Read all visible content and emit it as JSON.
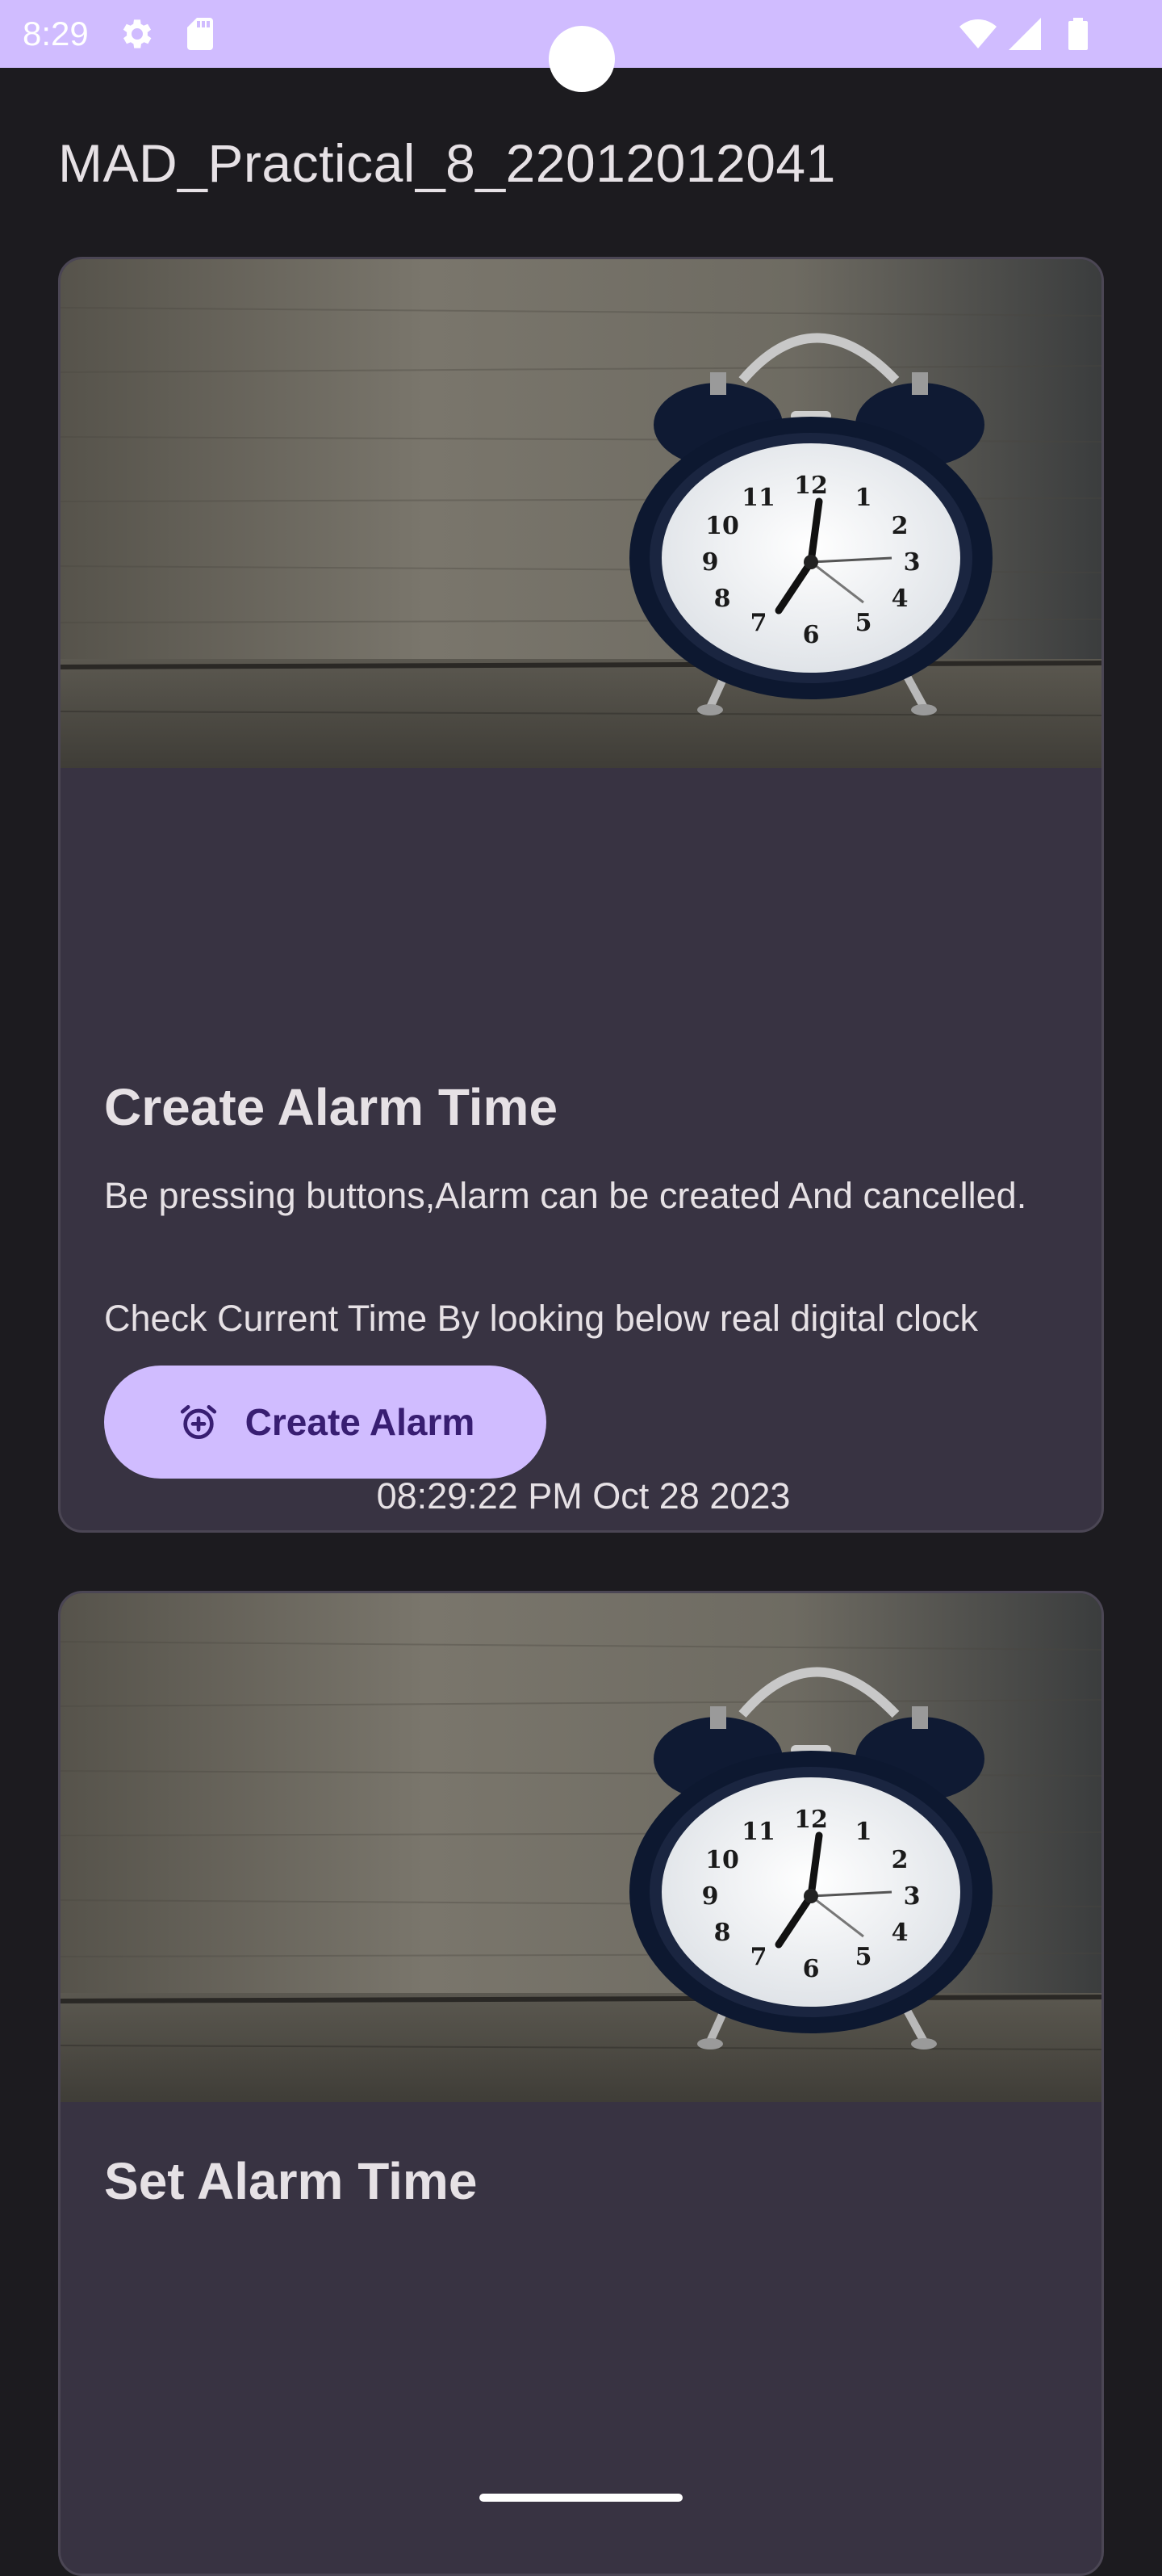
{
  "status_bar": {
    "time": "8:29",
    "icons": [
      "gear-icon",
      "sd-card-icon",
      "wifi-icon",
      "signal-icon",
      "battery-icon"
    ],
    "color": "#d0bcff"
  },
  "app": {
    "title": "MAD_Practical_8_22012012041"
  },
  "card_create": {
    "image": "alarm-clock-image",
    "title": "Create Alarm Time",
    "description": "Be pressing buttons,Alarm can be created And cancelled.",
    "hint": "Check Current Time By looking below real digital clock",
    "clock": "08:29:22 PM Oct 28 2023",
    "button_label": "Create Alarm",
    "button_icon": "alarm-add-icon"
  },
  "card_set": {
    "image": "alarm-clock-image",
    "title": "Set Alarm Time"
  },
  "theme": {
    "background": "#1c1b1f",
    "card": "#383342",
    "accent": "#d0bcff",
    "on_accent": "#381e72",
    "text": "#e6e1e5"
  }
}
